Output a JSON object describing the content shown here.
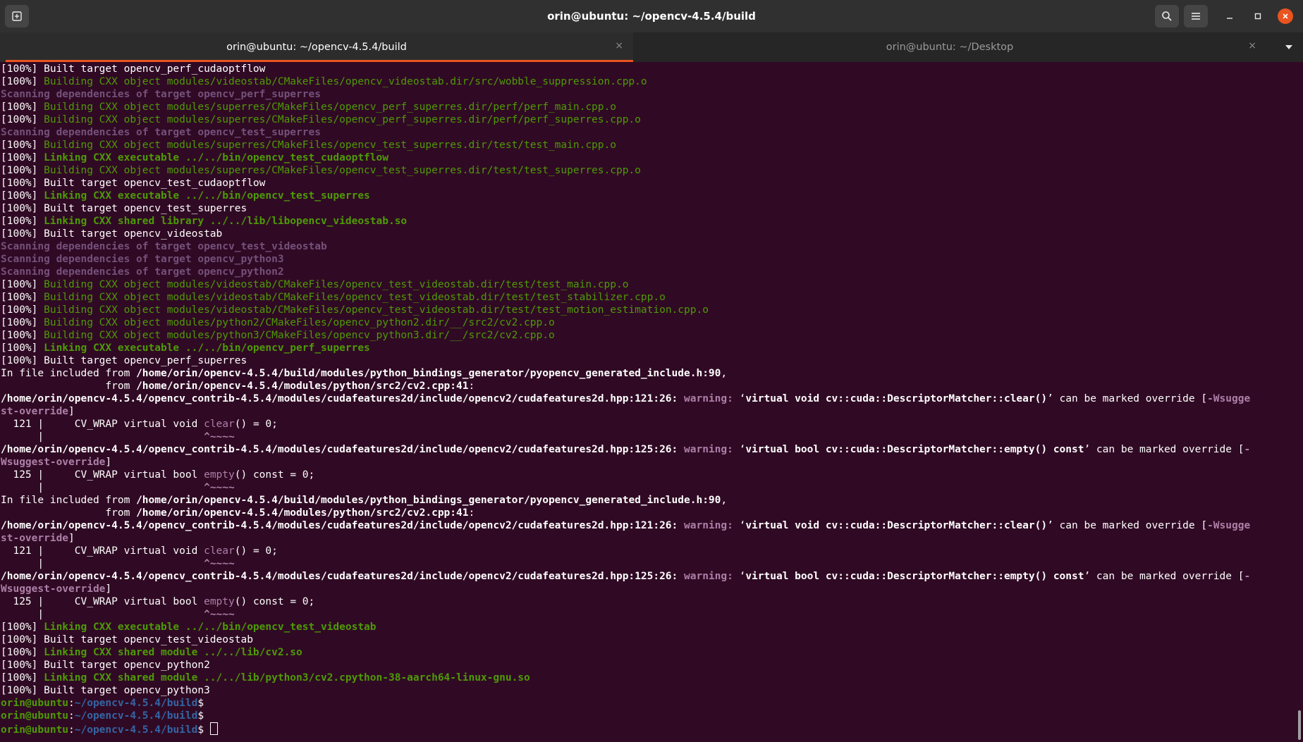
{
  "window": {
    "title": "orin@ubuntu: ~/opencv-4.5.4/build",
    "colors": {
      "background": "#300a24",
      "accent": "#e95420",
      "green": "#4e9a06",
      "purple": "#75507b",
      "blue": "#3465a4"
    }
  },
  "tabs": [
    {
      "label": "orin@ubuntu: ~/opencv-4.5.4/build",
      "close": "×"
    },
    {
      "label": "orin@ubuntu: ~/Desktop",
      "close": "×"
    }
  ],
  "icons": {
    "new_tab": "new-tab-icon",
    "search": "search-icon",
    "menu": "hamburger-menu-icon",
    "minimize": "minimize-icon",
    "maximize": "maximize-icon",
    "close": "close-icon",
    "tab_menu": "chevron-down-icon"
  },
  "terminal": {
    "lines": [
      [
        {
          "t": "[100%] Built target opencv_perf_cudaoptflow",
          "c": "w"
        }
      ],
      [
        {
          "t": "[100%] ",
          "c": "w"
        },
        {
          "t": "Building CXX object modules/videostab/CMakeFiles/opencv_videostab.dir/src/wobble_suppression.cpp.o",
          "c": "g"
        }
      ],
      [
        {
          "t": "Scanning dependencies of target opencv_perf_superres",
          "c": "m"
        }
      ],
      [
        {
          "t": "[100%] ",
          "c": "w"
        },
        {
          "t": "Building CXX object modules/superres/CMakeFiles/opencv_perf_superres.dir/perf/perf_main.cpp.o",
          "c": "g"
        }
      ],
      [
        {
          "t": "[100%] ",
          "c": "w"
        },
        {
          "t": "Building CXX object modules/superres/CMakeFiles/opencv_perf_superres.dir/perf/perf_superres.cpp.o",
          "c": "g"
        }
      ],
      [
        {
          "t": "Scanning dependencies of target opencv_test_superres",
          "c": "m"
        }
      ],
      [
        {
          "t": "[100%] ",
          "c": "w"
        },
        {
          "t": "Building CXX object modules/superres/CMakeFiles/opencv_test_superres.dir/test/test_main.cpp.o",
          "c": "g"
        }
      ],
      [
        {
          "t": "[100%] ",
          "c": "w"
        },
        {
          "t": "Linking CXX executable ../../bin/opencv_test_cudaoptflow",
          "c": "gb"
        }
      ],
      [
        {
          "t": "[100%] ",
          "c": "w"
        },
        {
          "t": "Building CXX object modules/superres/CMakeFiles/opencv_test_superres.dir/test/test_superres.cpp.o",
          "c": "g"
        }
      ],
      [
        {
          "t": "[100%] Built target opencv_test_cudaoptflow",
          "c": "w"
        }
      ],
      [
        {
          "t": "[100%] ",
          "c": "w"
        },
        {
          "t": "Linking CXX executable ../../bin/opencv_test_superres",
          "c": "gb"
        }
      ],
      [
        {
          "t": "[100%] Built target opencv_test_superres",
          "c": "w"
        }
      ],
      [
        {
          "t": "[100%] ",
          "c": "w"
        },
        {
          "t": "Linking CXX shared library ../../lib/libopencv_videostab.so",
          "c": "gb"
        }
      ],
      [
        {
          "t": "[100%] Built target opencv_videostab",
          "c": "w"
        }
      ],
      [
        {
          "t": "Scanning dependencies of target opencv_test_videostab",
          "c": "m"
        }
      ],
      [
        {
          "t": "Scanning dependencies of target opencv_python3",
          "c": "m"
        }
      ],
      [
        {
          "t": "Scanning dependencies of target opencv_python2",
          "c": "m"
        }
      ],
      [
        {
          "t": "[100%] ",
          "c": "w"
        },
        {
          "t": "Building CXX object modules/videostab/CMakeFiles/opencv_test_videostab.dir/test/test_main.cpp.o",
          "c": "g"
        }
      ],
      [
        {
          "t": "[100%] ",
          "c": "w"
        },
        {
          "t": "Building CXX object modules/videostab/CMakeFiles/opencv_test_videostab.dir/test/test_stabilizer.cpp.o",
          "c": "g"
        }
      ],
      [
        {
          "t": "[100%] ",
          "c": "w"
        },
        {
          "t": "Building CXX object modules/videostab/CMakeFiles/opencv_test_videostab.dir/test/test_motion_estimation.cpp.o",
          "c": "g"
        }
      ],
      [
        {
          "t": "[100%] ",
          "c": "w"
        },
        {
          "t": "Building CXX object modules/python2/CMakeFiles/opencv_python2.dir/__/src2/cv2.cpp.o",
          "c": "g"
        }
      ],
      [
        {
          "t": "[100%] ",
          "c": "w"
        },
        {
          "t": "Building CXX object modules/python3/CMakeFiles/opencv_python3.dir/__/src2/cv2.cpp.o",
          "c": "g"
        }
      ],
      [
        {
          "t": "[100%] ",
          "c": "w"
        },
        {
          "t": "Linking CXX executable ../../bin/opencv_perf_superres",
          "c": "gb"
        }
      ],
      [
        {
          "t": "[100%] Built target opencv_perf_superres",
          "c": "w"
        }
      ],
      [
        {
          "t": "In file included from ",
          "c": "w"
        },
        {
          "t": "/home/orin/opencv-4.5.4/build/modules/python_bindings_generator/pyopencv_generated_include.h:90",
          "c": "wb"
        },
        {
          "t": ",",
          "c": "w"
        }
      ],
      [
        {
          "t": "                 from ",
          "c": "w"
        },
        {
          "t": "/home/orin/opencv-4.5.4/modules/python/src2/cv2.cpp:41",
          "c": "wb"
        },
        {
          "t": ":",
          "c": "w"
        }
      ],
      [
        {
          "t": "/home/orin/opencv-4.5.4/opencv_contrib-4.5.4/modules/cudafeatures2d/include/opencv2/cudafeatures2d.hpp:121:26:",
          "c": "wb"
        },
        {
          "t": " ",
          "c": "w"
        },
        {
          "t": "warning: ",
          "c": "p"
        },
        {
          "t": "‘",
          "c": "w"
        },
        {
          "t": "virtual void cv::cuda::DescriptorMatcher::clear()",
          "c": "wb"
        },
        {
          "t": "’ can be marked override [",
          "c": "w"
        },
        {
          "t": "-Wsugge",
          "c": "p"
        }
      ],
      [
        {
          "t": "st-override",
          "c": "p"
        },
        {
          "t": "]",
          "c": "w"
        }
      ],
      [
        {
          "t": "  121 |     CV_WRAP virtual void ",
          "c": "w"
        },
        {
          "t": "clear",
          "c": "caret"
        },
        {
          "t": "() = 0;",
          "c": "w"
        }
      ],
      [
        {
          "t": "      |                          ",
          "c": "w"
        },
        {
          "t": "^~~~~",
          "c": "p"
        }
      ],
      [
        {
          "t": "/home/orin/opencv-4.5.4/opencv_contrib-4.5.4/modules/cudafeatures2d/include/opencv2/cudafeatures2d.hpp:125:26:",
          "c": "wb"
        },
        {
          "t": " ",
          "c": "w"
        },
        {
          "t": "warning: ",
          "c": "p"
        },
        {
          "t": "‘",
          "c": "w"
        },
        {
          "t": "virtual bool cv::cuda::DescriptorMatcher::empty() const",
          "c": "wb"
        },
        {
          "t": "’ can be marked override [",
          "c": "w"
        },
        {
          "t": "-",
          "c": "p"
        }
      ],
      [
        {
          "t": "Wsuggest-override",
          "c": "p"
        },
        {
          "t": "]",
          "c": "w"
        }
      ],
      [
        {
          "t": "  125 |     CV_WRAP virtual bool ",
          "c": "w"
        },
        {
          "t": "empty",
          "c": "caret"
        },
        {
          "t": "() const = 0;",
          "c": "w"
        }
      ],
      [
        {
          "t": "      |                          ",
          "c": "w"
        },
        {
          "t": "^~~~~",
          "c": "p"
        }
      ],
      [
        {
          "t": "In file included from ",
          "c": "w"
        },
        {
          "t": "/home/orin/opencv-4.5.4/build/modules/python_bindings_generator/pyopencv_generated_include.h:90",
          "c": "wb"
        },
        {
          "t": ",",
          "c": "w"
        }
      ],
      [
        {
          "t": "                 from ",
          "c": "w"
        },
        {
          "t": "/home/orin/opencv-4.5.4/modules/python/src2/cv2.cpp:41",
          "c": "wb"
        },
        {
          "t": ":",
          "c": "w"
        }
      ],
      [
        {
          "t": "/home/orin/opencv-4.5.4/opencv_contrib-4.5.4/modules/cudafeatures2d/include/opencv2/cudafeatures2d.hpp:121:26:",
          "c": "wb"
        },
        {
          "t": " ",
          "c": "w"
        },
        {
          "t": "warning: ",
          "c": "p"
        },
        {
          "t": "‘",
          "c": "w"
        },
        {
          "t": "virtual void cv::cuda::DescriptorMatcher::clear()",
          "c": "wb"
        },
        {
          "t": "’ can be marked override [",
          "c": "w"
        },
        {
          "t": "-Wsugge",
          "c": "p"
        }
      ],
      [
        {
          "t": "st-override",
          "c": "p"
        },
        {
          "t": "]",
          "c": "w"
        }
      ],
      [
        {
          "t": "  121 |     CV_WRAP virtual void ",
          "c": "w"
        },
        {
          "t": "clear",
          "c": "caret"
        },
        {
          "t": "() = 0;",
          "c": "w"
        }
      ],
      [
        {
          "t": "      |                          ",
          "c": "w"
        },
        {
          "t": "^~~~~",
          "c": "p"
        }
      ],
      [
        {
          "t": "/home/orin/opencv-4.5.4/opencv_contrib-4.5.4/modules/cudafeatures2d/include/opencv2/cudafeatures2d.hpp:125:26:",
          "c": "wb"
        },
        {
          "t": " ",
          "c": "w"
        },
        {
          "t": "warning: ",
          "c": "p"
        },
        {
          "t": "‘",
          "c": "w"
        },
        {
          "t": "virtual bool cv::cuda::DescriptorMatcher::empty() const",
          "c": "wb"
        },
        {
          "t": "’ can be marked override [",
          "c": "w"
        },
        {
          "t": "-",
          "c": "p"
        }
      ],
      [
        {
          "t": "Wsuggest-override",
          "c": "p"
        },
        {
          "t": "]",
          "c": "w"
        }
      ],
      [
        {
          "t": "  125 |     CV_WRAP virtual bool ",
          "c": "w"
        },
        {
          "t": "empty",
          "c": "caret"
        },
        {
          "t": "() const = 0;",
          "c": "w"
        }
      ],
      [
        {
          "t": "      |                          ",
          "c": "w"
        },
        {
          "t": "^~~~~",
          "c": "p"
        }
      ],
      [
        {
          "t": "[100%] ",
          "c": "w"
        },
        {
          "t": "Linking CXX executable ../../bin/opencv_test_videostab",
          "c": "gb"
        }
      ],
      [
        {
          "t": "[100%] Built target opencv_test_videostab",
          "c": "w"
        }
      ],
      [
        {
          "t": "[100%] ",
          "c": "w"
        },
        {
          "t": "Linking CXX shared module ../../lib/cv2.so",
          "c": "gb"
        }
      ],
      [
        {
          "t": "[100%] Built target opencv_python2",
          "c": "w"
        }
      ],
      [
        {
          "t": "[100%] ",
          "c": "w"
        },
        {
          "t": "Linking CXX shared module ../../lib/python3/cv2.cpython-38-aarch64-linux-gnu.so",
          "c": "gb"
        }
      ],
      [
        {
          "t": "[100%] Built target opencv_python3",
          "c": "w"
        }
      ]
    ],
    "prompts": [
      {
        "user": "orin@ubuntu",
        "sep": ":",
        "path": "~/opencv-4.5.4/build",
        "symbol": "$ "
      },
      {
        "user": "orin@ubuntu",
        "sep": ":",
        "path": "~/opencv-4.5.4/build",
        "symbol": "$ "
      },
      {
        "user": "orin@ubuntu",
        "sep": ":",
        "path": "~/opencv-4.5.4/build",
        "symbol": "$ "
      }
    ]
  }
}
